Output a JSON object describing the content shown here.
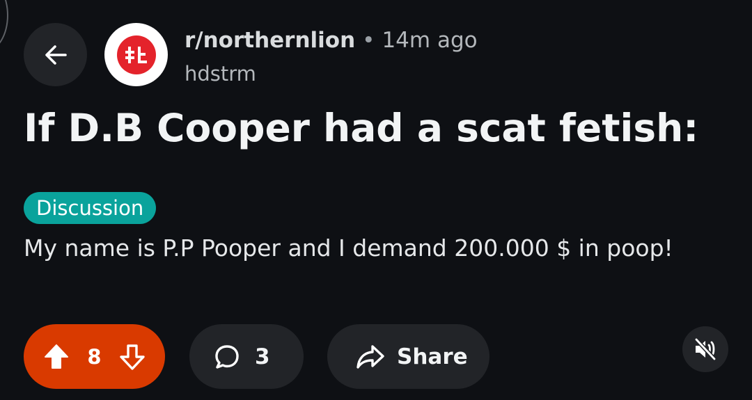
{
  "post": {
    "subreddit": "r/northernlion",
    "separator": "•",
    "time_ago": "14m ago",
    "author": "hdstrm",
    "title": "If D.B Cooper had a scat fetish:",
    "flair": "Discussion",
    "body": "My name is P.P Pooper and I demand 200.000 $ in poop!"
  },
  "actions": {
    "vote_count": "8",
    "comment_count": "3",
    "share_label": "Share"
  },
  "icons": {
    "back": "arrow-left-icon",
    "avatar": "subreddit-avatar",
    "upvote": "upvote-arrow-icon",
    "downvote": "downvote-arrow-icon",
    "comment": "comment-bubble-icon",
    "share": "share-arrow-icon",
    "mute": "muted-speaker-icon"
  },
  "colors": {
    "background": "#0e1014",
    "vote_active": "#d93a00",
    "flair_bg": "#0aa39c",
    "pill_bg": "#222428",
    "avatar_red": "#e4232b"
  }
}
